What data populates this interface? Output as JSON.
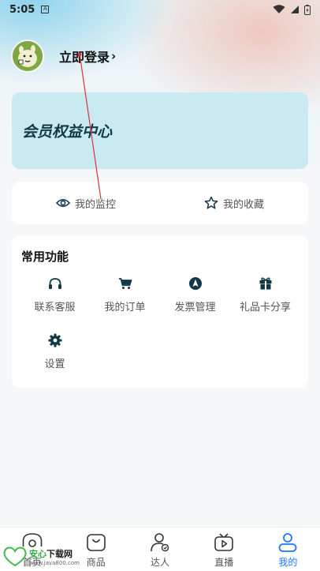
{
  "status_bar": {
    "time": "5:05",
    "notification_glyph": "A"
  },
  "profile": {
    "login_label": "立即登录",
    "chevron": "›"
  },
  "member_card": {
    "title": "会员权益中心",
    "background": "#c9eaf1"
  },
  "quick_links": [
    {
      "label": "我的监控",
      "icon": "eye-icon"
    },
    {
      "label": "我的收藏",
      "icon": "star-icon"
    }
  ],
  "functions": {
    "title": "常用功能",
    "items": [
      {
        "label": "联系客服",
        "icon": "headset-icon"
      },
      {
        "label": "我的订单",
        "icon": "cart-icon"
      },
      {
        "label": "发票管理",
        "icon": "compass-icon"
      },
      {
        "label": "礼品卡分享",
        "icon": "gift-icon"
      },
      {
        "label": "设置",
        "icon": "gear-icon"
      }
    ]
  },
  "tabbar": {
    "items": [
      {
        "label": "首页",
        "icon": "home-icon"
      },
      {
        "label": "商品",
        "icon": "bag-icon"
      },
      {
        "label": "达人",
        "icon": "person-icon"
      },
      {
        "label": "直播",
        "icon": "tv-icon"
      },
      {
        "label": "我的",
        "icon": "user-icon"
      }
    ],
    "active_index": 4,
    "active_color": "#1e78ff"
  },
  "watermark": {
    "brand_green": "安心",
    "brand_dark": "下载网",
    "url": "www.java800.com",
    "badge": "安心下载"
  },
  "colors": {
    "icon_dark": "#123848",
    "text_muted": "#555555",
    "annotation_red": "#d9333f"
  }
}
